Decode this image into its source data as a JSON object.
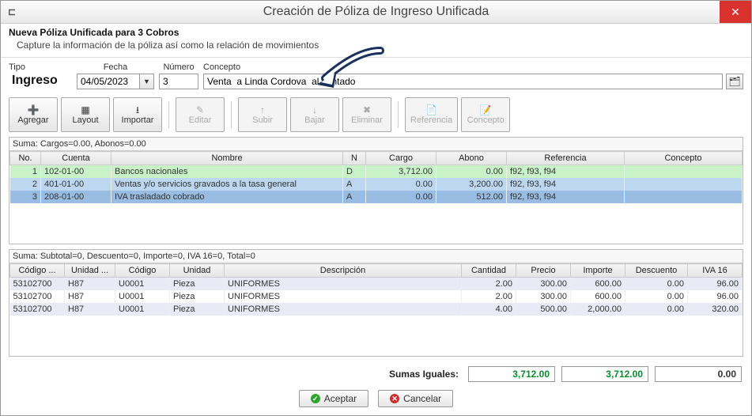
{
  "title_icon_glyph": "⊏",
  "title": "Creación de Póliza de Ingreso Unificada",
  "subheader": {
    "title": "Nueva Póliza Unificada para 3 Cobros",
    "subtitle": "Capture la información de la póliza así como la relación de movimientos"
  },
  "form": {
    "tipo_label": "Tipo",
    "tipo_value": "Ingreso",
    "fecha_label": "Fecha",
    "fecha_value": "04/05/2023",
    "numero_label": "Número",
    "numero_value": "3",
    "concepto_label": "Concepto",
    "concepto_value": "Venta  a Linda Cordova  al contado"
  },
  "toolbar": [
    {
      "key": "agregar",
      "label": "Agregar",
      "icon": "➕",
      "enabled": true
    },
    {
      "key": "layout",
      "label": "Layout",
      "icon": "▦",
      "enabled": true
    },
    {
      "key": "importar",
      "label": "Importar",
      "icon": "⭳",
      "enabled": true
    },
    {
      "key": "editar",
      "label": "Editar",
      "icon": "✎",
      "enabled": false
    },
    {
      "key": "subir",
      "label": "Subir",
      "icon": "↑",
      "enabled": false
    },
    {
      "key": "bajar",
      "label": "Bajar",
      "icon": "↓",
      "enabled": false
    },
    {
      "key": "eliminar",
      "label": "Eliminar",
      "icon": "✖",
      "enabled": false
    },
    {
      "key": "referencia",
      "label": "Referencia",
      "icon": "📄",
      "enabled": false
    },
    {
      "key": "concepto",
      "label": "Concepto",
      "icon": "📝",
      "enabled": false
    }
  ],
  "grid1": {
    "suma_text": "Suma:  Cargos=0.00,  Abonos=0.00",
    "headers": {
      "no": "No.",
      "cuenta": "Cuenta",
      "nombre": "Nombre",
      "n": "N",
      "cargo": "Cargo",
      "abono": "Abono",
      "referencia": "Referencia",
      "concepto": "Concepto"
    },
    "rows": [
      {
        "no": "1",
        "cuenta": "102-01-00",
        "nombre": "Bancos nacionales",
        "n": "D",
        "cargo": "3,712.00",
        "abono": "0.00",
        "referencia": "f92, f93, f94",
        "concepto": "",
        "class": "row-green"
      },
      {
        "no": "2",
        "cuenta": "401-01-00",
        "nombre": "Ventas y/o servicios gravados a la tasa general",
        "n": "A",
        "cargo": "0.00",
        "abono": "3,200.00",
        "referencia": "f92, f93, f94",
        "concepto": "",
        "class": "row-blue"
      },
      {
        "no": "3",
        "cuenta": "208-01-00",
        "nombre": "IVA trasladado cobrado",
        "n": "A",
        "cargo": "0.00",
        "abono": "512.00",
        "referencia": "f92, f93, f94",
        "concepto": "",
        "class": "row-sel"
      }
    ]
  },
  "grid2": {
    "suma_text": "Suma:  Subtotal=0,  Descuento=0,  Importe=0,  IVA 16=0,  Total=0",
    "headers": {
      "codigo": "Código ...",
      "unidadsat": "Unidad ...",
      "codigo2": "Código",
      "unidad": "Unidad",
      "desc": "Descripción",
      "cantidad": "Cantidad",
      "precio": "Precio",
      "importe": "Importe",
      "descuento": "Descuento",
      "iva": "IVA 16"
    },
    "rows": [
      {
        "codigo": "53102700",
        "unidadsat": "H87",
        "codigo2": "U0001",
        "unidad": "Pieza",
        "desc": "UNIFORMES",
        "cantidad": "2.00",
        "precio": "300.00",
        "importe": "600.00",
        "descuento": "0.00",
        "iva": "96.00",
        "class": "row-lav"
      },
      {
        "codigo": "53102700",
        "unidadsat": "H87",
        "codigo2": "U0001",
        "unidad": "Pieza",
        "desc": "UNIFORMES",
        "cantidad": "2.00",
        "precio": "300.00",
        "importe": "600.00",
        "descuento": "0.00",
        "iva": "96.00",
        "class": ""
      },
      {
        "codigo": "53102700",
        "unidadsat": "H87",
        "codigo2": "U0001",
        "unidad": "Pieza",
        "desc": "UNIFORMES",
        "cantidad": "4.00",
        "precio": "500.00",
        "importe": "2,000.00",
        "descuento": "0.00",
        "iva": "320.00",
        "class": "row-lav"
      }
    ]
  },
  "totals": {
    "label": "Sumas Iguales:",
    "cargo": "3,712.00",
    "abono": "3,712.00",
    "diff": "0.00"
  },
  "buttons": {
    "accept": "Aceptar",
    "cancel": "Cancelar"
  }
}
